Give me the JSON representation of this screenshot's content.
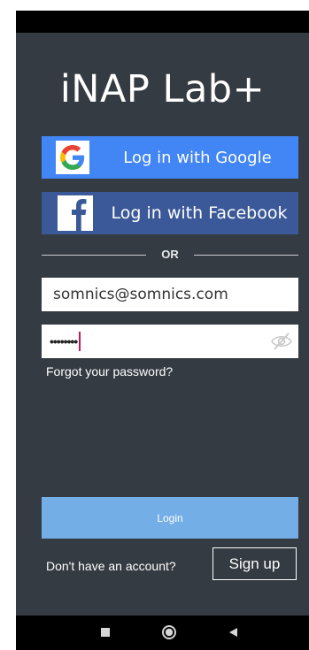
{
  "app": {
    "title": "iNAP Lab+"
  },
  "social": {
    "google_label": "Log in with Google",
    "facebook_label": "Log in with Facebook"
  },
  "divider": {
    "text": "OR"
  },
  "form": {
    "email_value": "somnics@somnics.com",
    "password_masked": "••••••••",
    "forgot_label": "Forgot your password?"
  },
  "actions": {
    "login_label": "Login",
    "no_account_text": "Don't have an account?",
    "signup_label": "Sign up"
  },
  "colors": {
    "background": "#353b42",
    "google_blue": "#4285f4",
    "facebook_blue": "#3b5998",
    "login_blue": "#73aee7"
  },
  "navigation": {
    "recents_icon": "square-icon",
    "home_icon": "circle-icon",
    "back_icon": "triangle-left-icon"
  }
}
